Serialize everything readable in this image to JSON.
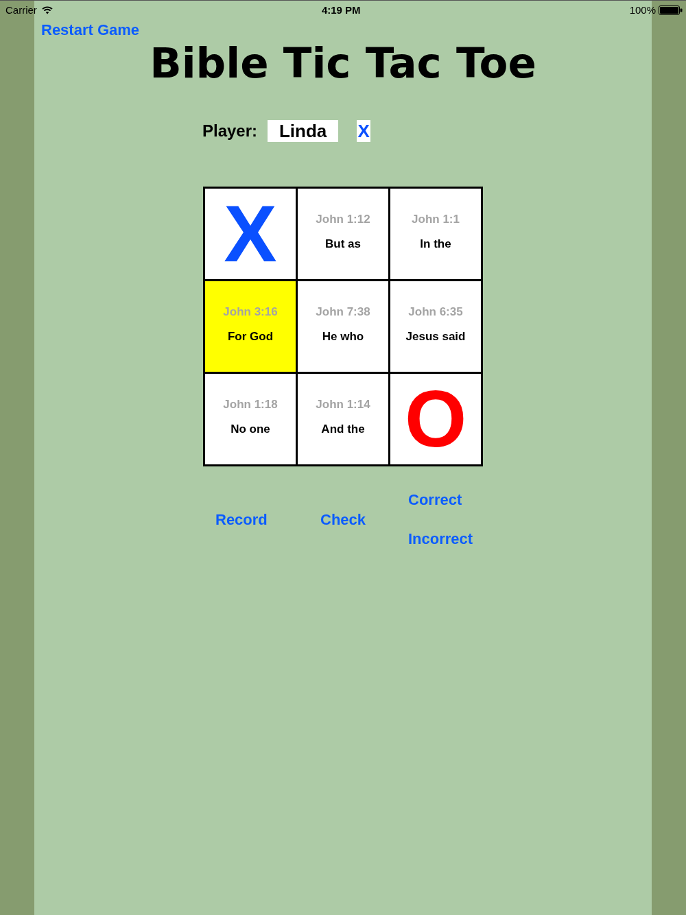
{
  "status_bar": {
    "carrier": "Carrier",
    "time": "4:19 PM",
    "battery": "100%"
  },
  "restart_button": "Restart Game",
  "title": "Bible Tic Tac Toe",
  "player": {
    "label": "Player:",
    "name": "Linda",
    "mark": "X",
    "color": "#0a50ff"
  },
  "board": {
    "cells": [
      {
        "kind": "mark",
        "mark": "X",
        "color": "#0a50ff",
        "selected": false
      },
      {
        "kind": "verse",
        "reference": "John 1:12",
        "text": "But as",
        "selected": false
      },
      {
        "kind": "verse",
        "reference": "John 1:1",
        "text": "In the",
        "selected": false
      },
      {
        "kind": "verse",
        "reference": "John 3:16",
        "text": "For God",
        "selected": true
      },
      {
        "kind": "verse",
        "reference": "John 7:38",
        "text": "He who",
        "selected": false
      },
      {
        "kind": "verse",
        "reference": "John 6:35",
        "text": "Jesus said",
        "selected": false
      },
      {
        "kind": "verse",
        "reference": "John 1:18",
        "text": "No one",
        "selected": false
      },
      {
        "kind": "verse",
        "reference": "John 1:14",
        "text": "And the",
        "selected": false
      },
      {
        "kind": "mark",
        "mark": "O",
        "color": "#ff0000",
        "selected": false
      }
    ]
  },
  "actions": {
    "record": "Record",
    "check": "Check",
    "correct": "Correct",
    "incorrect": "Incorrect"
  }
}
